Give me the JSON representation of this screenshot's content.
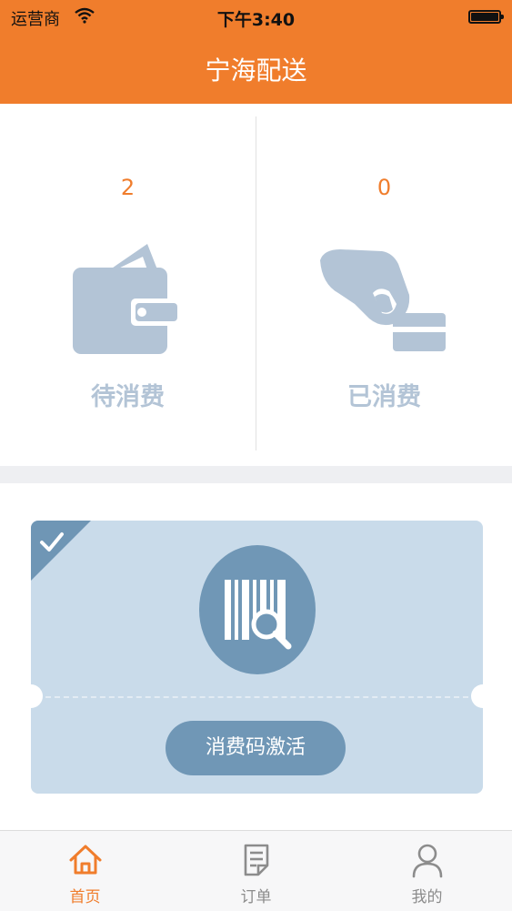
{
  "status_bar": {
    "carrier": "运营商",
    "time": "下午3:40"
  },
  "header": {
    "title": "宁海配送"
  },
  "stats": [
    {
      "count": "2",
      "label": "待消费",
      "icon": "wallet-icon"
    },
    {
      "count": "0",
      "label": "已消费",
      "icon": "hand-card-icon"
    }
  ],
  "coupon": {
    "button_label": "消费码激活",
    "icon": "barcode-search-icon"
  },
  "tabbar": {
    "items": [
      {
        "label": "首页",
        "icon": "home-icon",
        "active": true
      },
      {
        "label": "订单",
        "icon": "order-icon",
        "active": false
      },
      {
        "label": "我的",
        "icon": "user-icon",
        "active": false
      }
    ]
  },
  "colors": {
    "brand": "#f07d2c",
    "icon_gray": "#b3c4d6",
    "ticket": "#c9dbea",
    "button": "#7097b6"
  }
}
